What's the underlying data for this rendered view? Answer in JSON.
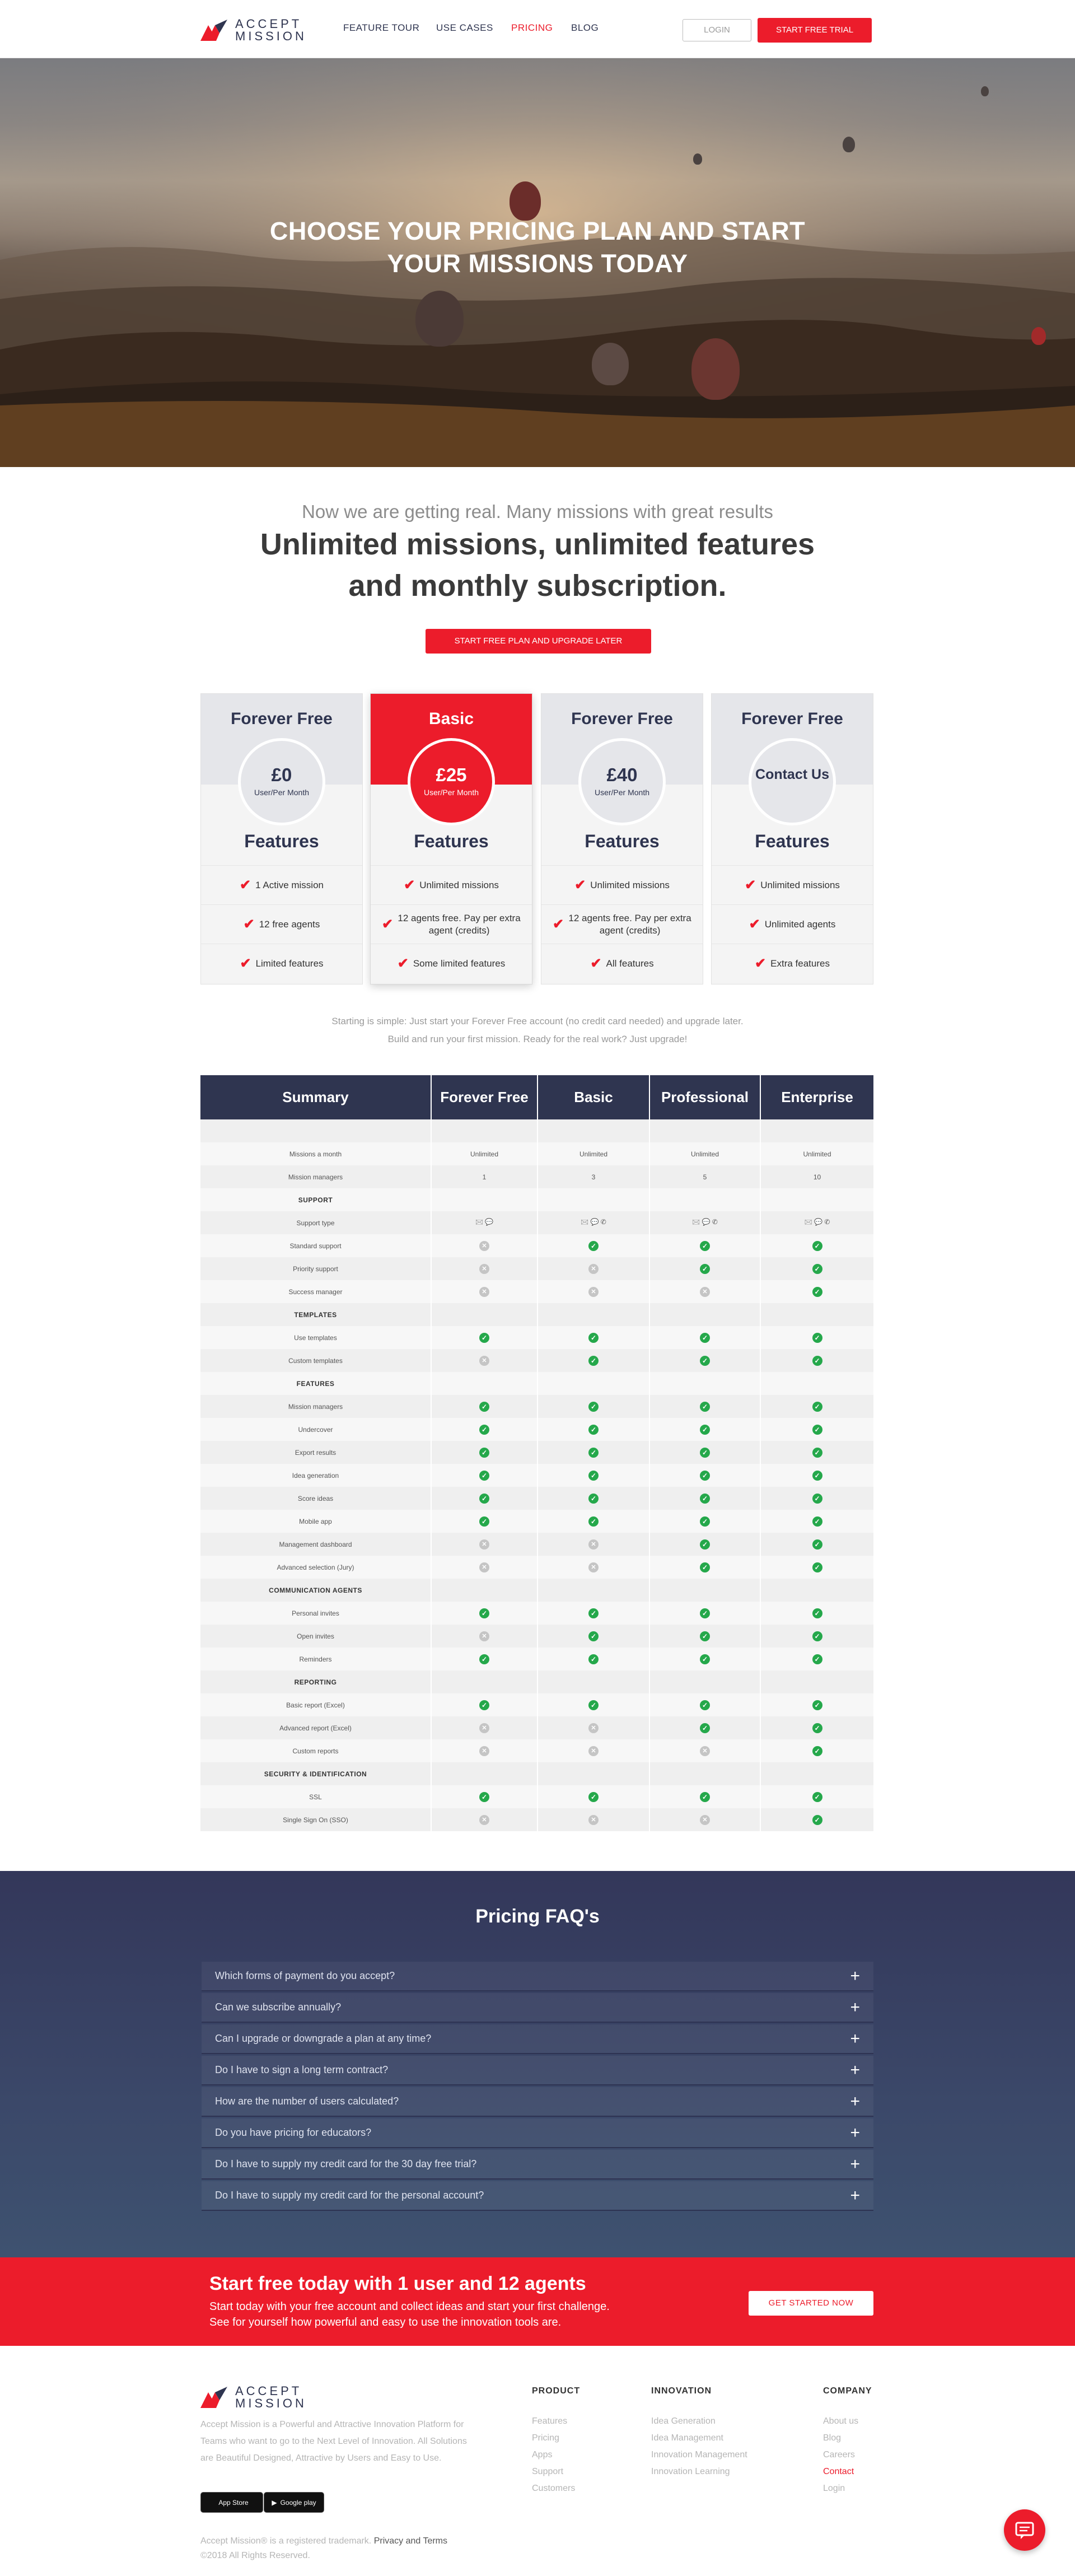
{
  "header": {
    "logo_line1": "ACCEPT",
    "logo_line2": "MISSION",
    "nav": [
      "FEATURE TOUR",
      "USE CASES",
      "PRICING",
      "BLOG"
    ],
    "active_nav_color": "#ec1c2b",
    "login_label": "LOGIN",
    "trial_label": "START FREE TRIAL"
  },
  "hero": {
    "title_line1": "CHOOSE YOUR PRICING PLAN AND START",
    "title_line2": "YOUR MISSIONS TODAY"
  },
  "intro": {
    "subtitle": "Now we are getting real. Many missions with great results",
    "title_line1": "Unlimited missions, unlimited features",
    "title_line2": "and monthly subscription.",
    "button": "START FREE PLAN AND UPGRADE LATER"
  },
  "plans": [
    {
      "name": "Forever Free",
      "price": "£0",
      "per": "User/Per Month",
      "features_label": "Features",
      "items": [
        "1 Active mission",
        "12 free agents",
        "Limited features"
      ]
    },
    {
      "name": "Basic",
      "price": "£25",
      "per": "User/Per Month",
      "features_label": "Features",
      "items": [
        "Unlimited missions",
        "12 agents free. Pay per extra agent (credits)",
        "Some limited features"
      ]
    },
    {
      "name": "Forever Free",
      "price": "£40",
      "per": "User/Per Month",
      "features_label": "Features",
      "items": [
        "Unlimited missions",
        "12 agents free. Pay per extra agent (credits)",
        "All features"
      ]
    },
    {
      "name": "Forever Free",
      "contact": "Contact Us",
      "features_label": "Features",
      "items": [
        "Unlimited missions",
        "Unlimited agents",
        "Extra features"
      ]
    }
  ],
  "plans_note": {
    "line1": "Starting is simple: Just start your Forever Free account (no credit card needed) and upgrade later.",
    "line2": "Build and run your first mission. Ready for the real work? Just upgrade!"
  },
  "compare": {
    "headers": [
      "Summary",
      "Forever Free",
      "Basic",
      "Professional",
      "Enterprise"
    ],
    "rows": [
      {
        "label": "",
        "values": [
          "",
          "",
          "",
          ""
        ]
      },
      {
        "label": "Missions a month",
        "values": [
          "Unlimited",
          "Unlimited",
          "Unlimited",
          "Unlimited"
        ]
      },
      {
        "label": "Mission managers",
        "values": [
          "1",
          "3",
          "5",
          "10"
        ]
      },
      {
        "label": "SUPPORT",
        "section": true
      },
      {
        "label": "Support type",
        "values": [
          "🖂 💬",
          "🖂 💬 ✆",
          "🖂 💬 ✆",
          "🖂 💬 ✆"
        ]
      },
      {
        "label": "Standard support",
        "values": [
          "no",
          "yes",
          "yes",
          "yes"
        ]
      },
      {
        "label": "Priority support",
        "values": [
          "no",
          "no",
          "yes",
          "yes"
        ]
      },
      {
        "label": "Success manager",
        "values": [
          "no",
          "no",
          "no",
          "yes"
        ]
      },
      {
        "label": "TEMPLATES",
        "section": true
      },
      {
        "label": "Use templates",
        "values": [
          "yes",
          "yes",
          "yes",
          "yes"
        ]
      },
      {
        "label": "Custom templates",
        "values": [
          "no",
          "yes",
          "yes",
          "yes"
        ]
      },
      {
        "label": "FEATURES",
        "section": true
      },
      {
        "label": "Mission managers",
        "values": [
          "yes",
          "yes",
          "yes",
          "yes"
        ]
      },
      {
        "label": "Undercover",
        "values": [
          "yes",
          "yes",
          "yes",
          "yes"
        ]
      },
      {
        "label": "Export results",
        "values": [
          "yes",
          "yes",
          "yes",
          "yes"
        ]
      },
      {
        "label": "Idea generation",
        "values": [
          "yes",
          "yes",
          "yes",
          "yes"
        ]
      },
      {
        "label": "Score ideas",
        "values": [
          "yes",
          "yes",
          "yes",
          "yes"
        ]
      },
      {
        "label": "Mobile app",
        "values": [
          "yes",
          "yes",
          "yes",
          "yes"
        ]
      },
      {
        "label": "Management dashboard",
        "values": [
          "no",
          "no",
          "yes",
          "yes"
        ]
      },
      {
        "label": "Advanced selection (Jury)",
        "values": [
          "no",
          "no",
          "yes",
          "yes"
        ]
      },
      {
        "label": "COMMUNICATION AGENTS",
        "section": true
      },
      {
        "label": "Personal invites",
        "values": [
          "yes",
          "yes",
          "yes",
          "yes"
        ]
      },
      {
        "label": "Open invites",
        "values": [
          "no",
          "yes",
          "yes",
          "yes"
        ]
      },
      {
        "label": "Reminders",
        "values": [
          "yes",
          "yes",
          "yes",
          "yes"
        ]
      },
      {
        "label": "REPORTING",
        "section": true
      },
      {
        "label": "Basic report (Excel)",
        "values": [
          "yes",
          "yes",
          "yes",
          "yes"
        ]
      },
      {
        "label": "Advanced report (Excel)",
        "values": [
          "no",
          "no",
          "yes",
          "yes"
        ]
      },
      {
        "label": "Custom reports",
        "values": [
          "no",
          "no",
          "no",
          "yes"
        ]
      },
      {
        "label": "SECURITY & IDENTIFICATION",
        "section": true
      },
      {
        "label": "SSL",
        "values": [
          "yes",
          "yes",
          "yes",
          "yes"
        ]
      },
      {
        "label": "Single Sign On (SSO)",
        "values": [
          "no",
          "no",
          "no",
          "yes"
        ]
      }
    ]
  },
  "faq": {
    "title": "Pricing FAQ's",
    "items": [
      "Which forms of payment do you accept?",
      "Can we subscribe annually?",
      "Can I upgrade or downgrade a plan at any time?",
      "Do I have to sign a long term contract?",
      "How are the number of users calculated?",
      "Do you have pricing for educators?",
      "Do I have to supply my credit card for the 30 day free trial?",
      "Do I have to supply my credit card for the personal account?"
    ]
  },
  "cta": {
    "title": "Start free today with 1 user and 12 agents",
    "text_line1": "Start today with your free account and collect ideas and start your first challenge.",
    "text_line2": "See for yourself how powerful and easy to use the innovation tools are.",
    "button": "GET STARTED NOW"
  },
  "footer": {
    "desc": "Accept Mission is a Powerful and Attractive Innovation Platform for Teams who want to go to the Next Level of Innovation. All Solutions are Beautiful Designed, Attractive by Users and Easy to Use.",
    "app_store": "App Store",
    "google_play": "Google play",
    "legal_prefix": "Accept Mission® is a registered trademark.",
    "privacy_terms": "Privacy and Terms",
    "copyright": "©2018 All Rights Reserved.",
    "columns": [
      {
        "title": "PRODUCT",
        "links": [
          "Features",
          "Pricing",
          "Apps",
          "Support",
          "Customers"
        ]
      },
      {
        "title": "INNOVATION",
        "links": [
          "Idea Generation",
          "Idea Management",
          "Innovation Management",
          "Innovation Learning"
        ]
      },
      {
        "title": "COMPANY",
        "links": [
          "About us",
          "Blog",
          "Careers",
          "Contact",
          "Login"
        ]
      }
    ],
    "contact_color": "#ec1c2b"
  },
  "chat_icon": "chat-icon"
}
